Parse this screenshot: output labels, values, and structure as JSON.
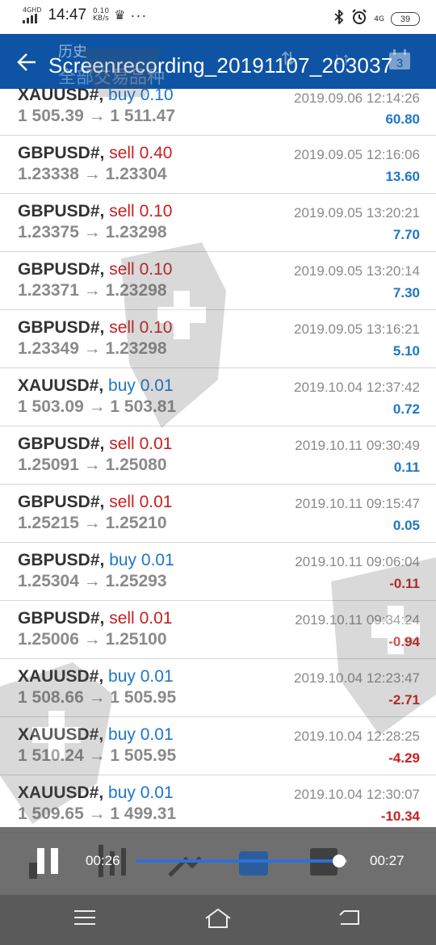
{
  "status_bar": {
    "network_tag": "4GHD",
    "time": "14:47",
    "speed_value": "0.10",
    "speed_unit": "KB/s",
    "more": "···",
    "net_type": "4G",
    "battery": "39"
  },
  "header": {
    "subtitle": "历史",
    "subtitle2": "全部交易品种",
    "recording_title": "Screenrecording_20191107_203037",
    "calendar_day": "3"
  },
  "trades": [
    {
      "symbol": "XAUUSD#,",
      "side": "buy",
      "volume": "0.10",
      "open": "1 505.39",
      "close": "1 511.47",
      "date": "2019.09.06 12:14:26",
      "profit": "60.80"
    },
    {
      "symbol": "GBPUSD#,",
      "side": "sell",
      "volume": "0.40",
      "open": "1.23338",
      "close": "1.23304",
      "date": "2019.09.05 12:16:06",
      "profit": "13.60"
    },
    {
      "symbol": "GBPUSD#,",
      "side": "sell",
      "volume": "0.10",
      "open": "1.23375",
      "close": "1.23298",
      "date": "2019.09.05 13:20:21",
      "profit": "7.70"
    },
    {
      "symbol": "GBPUSD#,",
      "side": "sell",
      "volume": "0.10",
      "open": "1.23371",
      "close": "1.23298",
      "date": "2019.09.05 13:20:14",
      "profit": "7.30"
    },
    {
      "symbol": "GBPUSD#,",
      "side": "sell",
      "volume": "0.10",
      "open": "1.23349",
      "close": "1.23298",
      "date": "2019.09.05 13:16:21",
      "profit": "5.10"
    },
    {
      "symbol": "XAUUSD#,",
      "side": "buy",
      "volume": "0.01",
      "open": "1 503.09",
      "close": "1 503.81",
      "date": "2019.10.04 12:37:42",
      "profit": "0.72"
    },
    {
      "symbol": "GBPUSD#,",
      "side": "sell",
      "volume": "0.01",
      "open": "1.25091",
      "close": "1.25080",
      "date": "2019.10.11 09:30:49",
      "profit": "0.11"
    },
    {
      "symbol": "GBPUSD#,",
      "side": "sell",
      "volume": "0.01",
      "open": "1.25215",
      "close": "1.25210",
      "date": "2019.10.11 09:15:47",
      "profit": "0.05"
    },
    {
      "symbol": "GBPUSD#,",
      "side": "buy",
      "volume": "0.01",
      "open": "1.25304",
      "close": "1.25293",
      "date": "2019.10.11 09:06:04",
      "profit": "-0.11"
    },
    {
      "symbol": "GBPUSD#,",
      "side": "sell",
      "volume": "0.01",
      "open": "1.25006",
      "close": "1.25100",
      "date": "2019.10.11 09:34:24",
      "profit": "-0.94"
    },
    {
      "symbol": "XAUUSD#,",
      "side": "buy",
      "volume": "0.01",
      "open": "1 508.66",
      "close": "1 505.95",
      "date": "2019.10.04 12:23:47",
      "profit": "-2.71"
    },
    {
      "symbol": "XAUUSD#,",
      "side": "buy",
      "volume": "0.01",
      "open": "1 510.24",
      "close": "1 505.95",
      "date": "2019.10.04 12:28:25",
      "profit": "-4.29"
    },
    {
      "symbol": "XAUUSD#,",
      "side": "buy",
      "volume": "0.01",
      "open": "1 509.65",
      "close": "1 499.31",
      "date": "2019.10.04 12:30:07",
      "profit": "-10.34"
    }
  ],
  "player": {
    "current_time": "00:26",
    "total_time": "00:27",
    "progress": 0.963,
    "accent": "#2f6fd9"
  },
  "colors": {
    "header_bg": "#0f54a4",
    "buy": "#1e76c8",
    "sell": "#c82020"
  },
  "icons": [
    "back-arrow-icon",
    "pause-icon",
    "menu-icon",
    "home-icon",
    "back-icon",
    "bluetooth-icon",
    "alarm-icon",
    "crown-icon",
    "calendar-icon"
  ]
}
